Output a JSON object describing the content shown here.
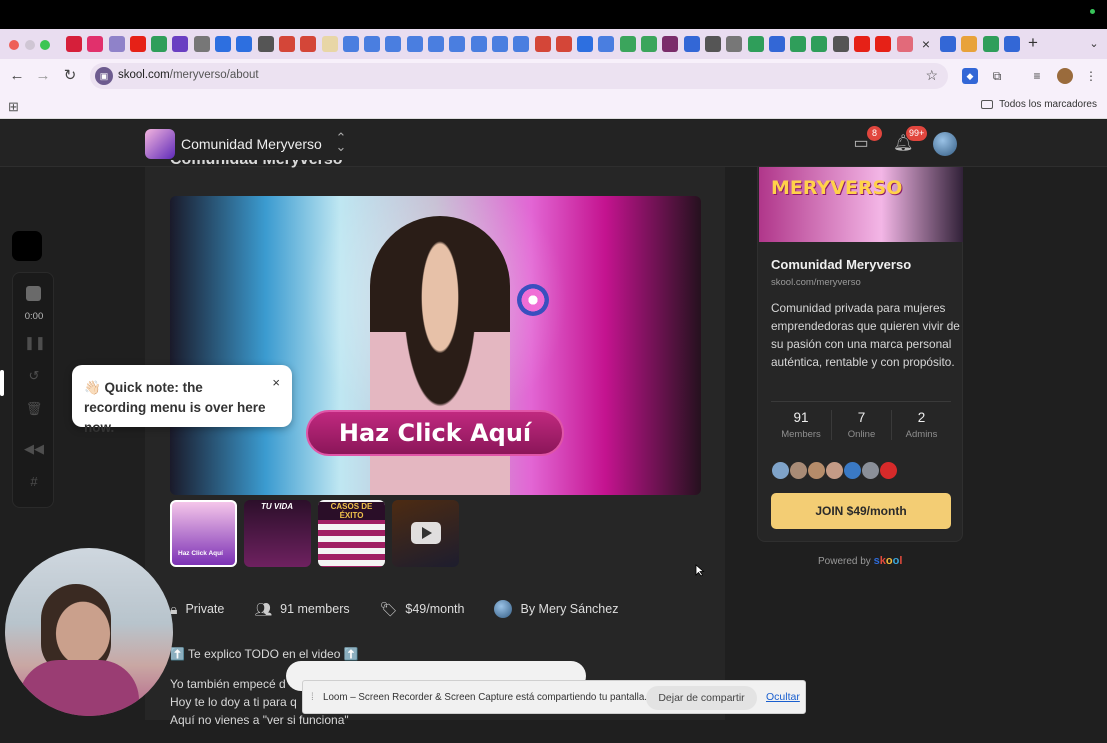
{
  "browser": {
    "url_host": "skool.com",
    "url_path": "/meryverso/about",
    "bookmarks_folder": "Todos los marcadores",
    "tab_close_glyph": "×",
    "new_tab_glyph": "+"
  },
  "header": {
    "community_name": "Comunidad Meryverso",
    "chat_badge": "8",
    "notifications_badge": "99+"
  },
  "main": {
    "title": "Comunidad Meryverso",
    "hero_cta": "Haz Click Aquí",
    "thumbnails": [
      {
        "label": "Haz Click Aquí"
      },
      {
        "label": "TU VIDA"
      },
      {
        "label": "CASOS DE ÉXITO"
      },
      {
        "label": ""
      }
    ],
    "meta": {
      "privacy": "Private",
      "members": "91 members",
      "price": "$49/month",
      "author": "By Mery Sánchez"
    },
    "description_lines": [
      "⬆️ Te explico TODO en el video ⬆️",
      "Yo también empecé d",
      "Hoy te lo doy a ti para q",
      "Aquí no vienes a \"ver si funciona\""
    ]
  },
  "sidebar": {
    "banner_text": "MERYVERSO",
    "title": "Comunidad Meryverso",
    "url": "skool.com/meryverso",
    "description": "Comunidad privada para mujeres emprendedoras que quieren vivir de su pasión con una marca personal auténtica, rentable y con propósito.",
    "stats": [
      {
        "value": "91",
        "label": "Members"
      },
      {
        "value": "7",
        "label": "Online"
      },
      {
        "value": "2",
        "label": "Admins"
      }
    ],
    "join_label": "JOIN $49/month",
    "powered_by": "Powered by",
    "powered_brand": "skool"
  },
  "recorder": {
    "time": "0:00",
    "tooltip": "👋🏻 Quick note: the recording menu is over here now.",
    "tooltip_close": "×"
  },
  "share_bar": {
    "message": "Loom – Screen Recorder & Screen Capture está compartiendo tu pantalla.",
    "stop_label": "Dejar de compartir",
    "hide_label": "Ocultar"
  },
  "colors": {
    "join_button": "#f3cd74",
    "badge": "#e1463e",
    "hero_cta": "#c0297f"
  }
}
